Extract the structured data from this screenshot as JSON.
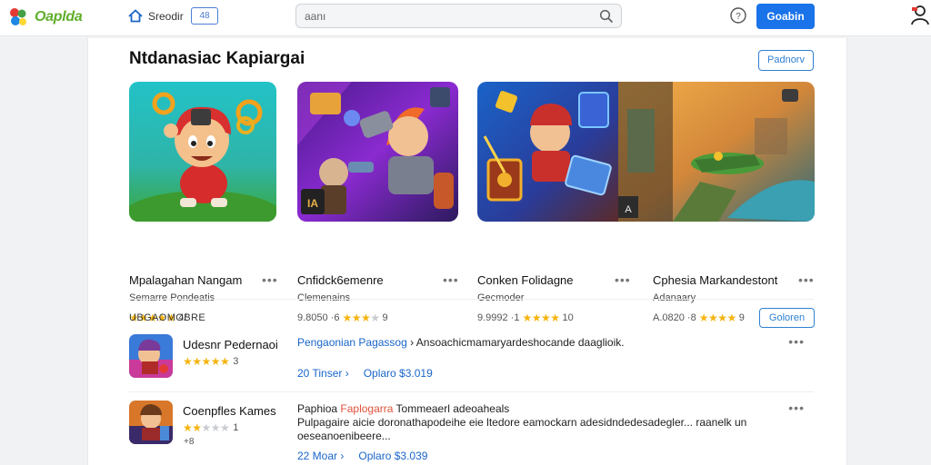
{
  "brand": {
    "name": "Oaplda",
    "logo_icon": "multicolor-puzzle-logo-icon"
  },
  "header": {
    "home_label": "Sreodir",
    "home_badge": "48",
    "search_text": "aanı",
    "signin_label": "Goabin",
    "accent": "#1a73e8"
  },
  "featured": {
    "title": "Ntdanasiac Kapiargai",
    "more_label": "Padnorv",
    "cards": [
      {
        "title": "Mpalagahan Nangam",
        "subtitle": "Semarre Pondeatis",
        "stars": 5,
        "rating_text": "4/",
        "menu": "•••"
      },
      {
        "title": "Cnfidck6emenre",
        "subtitle": "Clemenains",
        "stars": 3,
        "rating_text": "9.8050 ·6",
        "rating_suffix": "9",
        "menu": "•••"
      },
      {
        "title": "Conken Folidagne",
        "subtitle": "Gecmoder",
        "stars": 4,
        "rating_text": "9.9992 ·1",
        "rating_suffix": "10",
        "menu": "•••"
      },
      {
        "title": "Cphesia Markandestont",
        "subtitle": "Adanaary",
        "stars": 4,
        "rating_text": "A.0820 ·8",
        "rating_suffix": "9",
        "menu": "•••"
      }
    ]
  },
  "list": {
    "header": "UBGAOMOBRE",
    "more_label": "Goloren",
    "rows": [
      {
        "name": "Udesnr Pedernaoi",
        "stars": 5,
        "rating_text": "3",
        "extra": "",
        "desc_tag": "Pengaonian Pagassog",
        "desc_tag2": "",
        "desc_text": " › Ansoachicmamaryardeshocande daaglioik.",
        "desc_line2": "",
        "link1": "20 Tinser",
        "link2": "Oplaro $3.019",
        "menu": "•••"
      },
      {
        "name": "Coenpfles Kames",
        "stars": 2,
        "rating_text": "1",
        "extra": "+8",
        "desc_tag": "Paphioa",
        "desc_tag2": "Faplogarra",
        "desc_text": " Tommeaerl adeoaheals",
        "desc_line2": "Pulpagaire aicie doronathapodeihe eie ltedore eamockarn adesidndedesadegler... raanelk un oeseanoenibeere...",
        "link1": "22 Moar",
        "link2": "Oplaro $3.039",
        "menu": "•••"
      }
    ]
  }
}
